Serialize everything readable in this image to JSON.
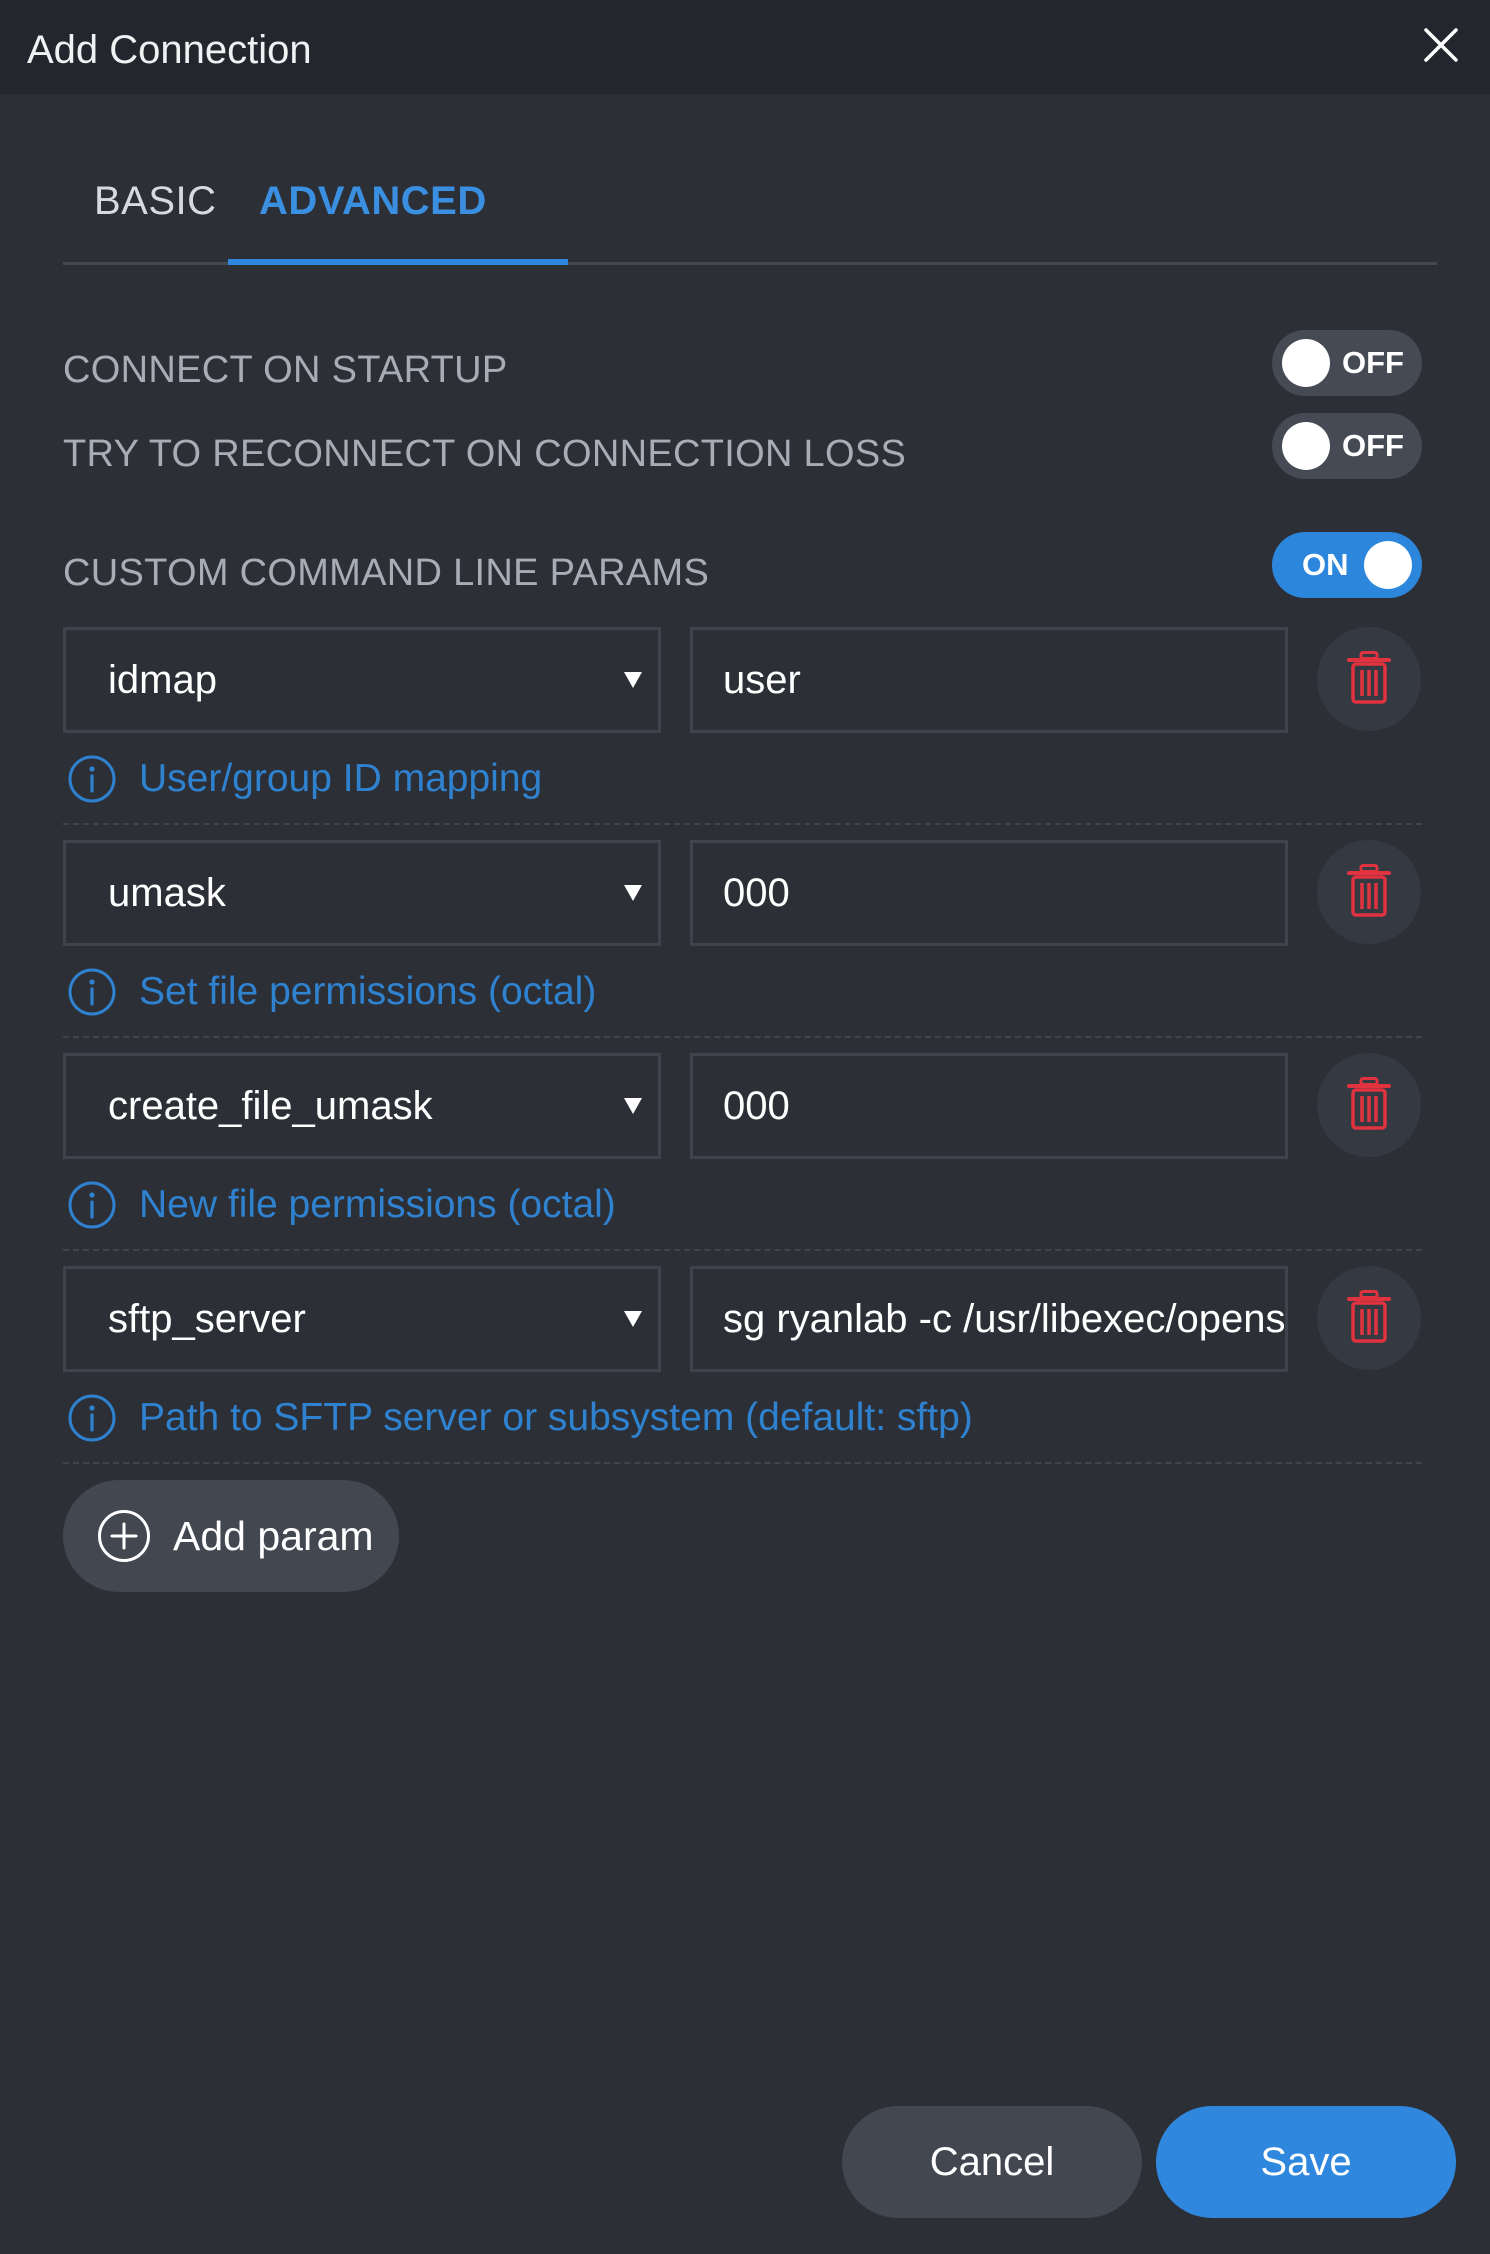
{
  "dialog": {
    "title": "Add Connection"
  },
  "tabs": [
    {
      "label": "BASIC",
      "active": false
    },
    {
      "label": "ADVANCED",
      "active": true
    }
  ],
  "settings": {
    "connect_on_startup": {
      "label": "CONNECT ON STARTUP",
      "state": "OFF"
    },
    "reconnect": {
      "label": "TRY TO RECONNECT ON CONNECTION LOSS",
      "state": "OFF"
    },
    "custom_params": {
      "label": "CUSTOM COMMAND LINE PARAMS",
      "state": "ON"
    }
  },
  "params": [
    {
      "name": "idmap",
      "value": "user",
      "hint": "User/group ID mapping"
    },
    {
      "name": "umask",
      "value": "000",
      "hint": "Set file permissions (octal)"
    },
    {
      "name": "create_file_umask",
      "value": "000",
      "hint": "New file permissions (octal)"
    },
    {
      "name": "sftp_server",
      "value": "sg ryanlab -c /usr/libexec/openssh/sftp-server",
      "hint": "Path to SFTP server or subsystem (default: sftp)"
    }
  ],
  "actions": {
    "add_param": "Add param",
    "cancel": "Cancel",
    "save": "Save"
  },
  "colors": {
    "background": "#2c2f36",
    "titlebar": "#23262c",
    "accent": "#2f88dd",
    "hint": "#2f82cf",
    "danger": "#e0333f"
  },
  "icons": {
    "close": "close-icon",
    "delete": "trash-icon",
    "info": "info-icon",
    "add": "plus-circle-icon",
    "dropdown": "caret-down-icon"
  }
}
